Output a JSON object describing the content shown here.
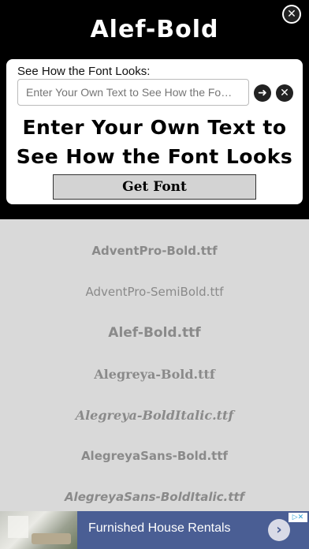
{
  "header": {
    "title": "Alef-Bold",
    "close_icon": "close-icon"
  },
  "panel": {
    "prompt": "See How the Font Looks:",
    "input_value": "",
    "input_placeholder": "Enter Your Own Text to See How the Fo…",
    "go_icon": "arrow-right-icon",
    "clear_icon": "clear-icon",
    "preview_line1": "Enter Your Own Text to",
    "preview_line2": "See How the Font Looks",
    "get_font_label": "Get Font"
  },
  "font_list": [
    "AdventPro-Bold.ttf",
    "AdventPro-SemiBold.ttf",
    "Alef-Bold.ttf",
    "Alegreya-Bold.ttf",
    "Alegreya-BoldItalic.ttf",
    "AlegreyaSans-Bold.ttf",
    "AlegreyaSans-BoldItalic.ttf"
  ],
  "ad": {
    "text": "Furnished House Rentals",
    "arrow_icon": "chevron-right-icon",
    "ad_choices_icon": "ad-choices-icon"
  },
  "colors": {
    "header_bg": "#000000",
    "list_bg": "#d9d9d9",
    "list_text": "#8a8a8a",
    "ad_bg": "#4a5e94"
  }
}
